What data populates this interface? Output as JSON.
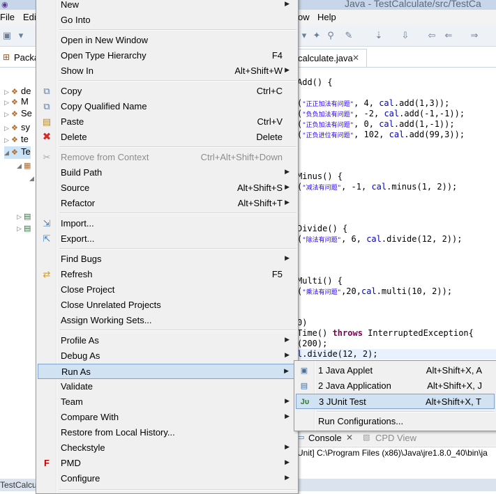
{
  "window": {
    "title": "Java - TestCalculate/src/TestCa"
  },
  "menubar": {
    "file": "File",
    "edit": "Edi",
    "window": "ow",
    "help": "Help"
  },
  "package_explorer": {
    "tab_label": "Packa",
    "tree": [
      {
        "label": "de"
      },
      {
        "label": "M"
      },
      {
        "label": "Se"
      },
      {
        "label": "sy"
      },
      {
        "label": "te"
      },
      {
        "label": "Te"
      }
    ]
  },
  "editor": {
    "tab_label": "calculate.java",
    "code_lines": {
      "l1": "Add() {",
      "l2_str": "\"正正加法有问题\"",
      "l2_rest": ", 4, ",
      "l2_f": "cal",
      "l2_end": ".add(1,3));",
      "l3_str": "\"负负加法有问题\"",
      "l3_rest": ", -2, ",
      "l3_f": "cal",
      "l3_end": ".add(-1,-1));",
      "l4_str": "\"正负加法有问题\"",
      "l4_rest": ", 0, ",
      "l4_f": "cal",
      "l4_end": ".add(1,-1));",
      "l5_str": "\"正负进位有问题\"",
      "l5_rest": ", 102, ",
      "l5_f": "cal",
      "l5_end": ".add(99,3));",
      "l6": "Minus() {",
      "l7_str": "\"减法有问题\"",
      "l7_rest": ", -1, ",
      "l7_f": "cal",
      "l7_end": ".minus(1, 2));",
      "l8": "Divide() {",
      "l9_str": "\"除法有问题\"",
      "l9_rest": ", 6, ",
      "l9_f": "cal",
      "l9_end": ".divide(12, 2));",
      "l10": "Multi() {",
      "l11_str": "\"乘法有问题\"",
      "l11_rest": ",20,",
      "l11_f": "cal",
      "l11_end": ".multi(10, 2));",
      "l12": "0)",
      "l13_a": "Time() ",
      "l13_k": "throws",
      "l13_b": " InterruptedException{",
      "l14": "(200);",
      "l15_f": "l",
      "l15_end": ".divide(12, 2);"
    }
  },
  "console": {
    "console_label": "Console",
    "cpd_label": "CPD View",
    "path": "Unit] C:\\Program Files (x86)\\Java\\jre1.8.0_40\\bin\\ja"
  },
  "bottom": {
    "label": "TestCalcul"
  },
  "context_menu": {
    "new": "New",
    "go_into": "Go Into",
    "open_new_window": "Open in New Window",
    "open_type_hierarchy": "Open Type Hierarchy",
    "open_type_hierarchy_sc": "F4",
    "show_in": "Show In",
    "show_in_sc": "Alt+Shift+W",
    "copy": "Copy",
    "copy_sc": "Ctrl+C",
    "copy_qualified": "Copy Qualified Name",
    "paste": "Paste",
    "paste_sc": "Ctrl+V",
    "delete": "Delete",
    "delete_sc": "Delete",
    "remove_context": "Remove from Context",
    "remove_context_sc": "Ctrl+Alt+Shift+Down",
    "build_path": "Build Path",
    "source": "Source",
    "source_sc": "Alt+Shift+S",
    "refactor": "Refactor",
    "refactor_sc": "Alt+Shift+T",
    "import": "Import...",
    "export": "Export...",
    "find_bugs": "Find Bugs",
    "refresh": "Refresh",
    "refresh_sc": "F5",
    "close_project": "Close Project",
    "close_unrelated": "Close Unrelated Projects",
    "assign_working_sets": "Assign Working Sets...",
    "profile_as": "Profile As",
    "debug_as": "Debug As",
    "run_as": "Run As",
    "validate": "Validate",
    "team": "Team",
    "compare_with": "Compare With",
    "restore_history": "Restore from Local History...",
    "checkstyle": "Checkstyle",
    "pmd": "PMD",
    "configure": "Configure"
  },
  "run_as_submenu": {
    "java_applet": "1 Java Applet",
    "java_applet_sc": "Alt+Shift+X, A",
    "java_application": "2 Java Application",
    "java_application_sc": "Alt+Shift+X, J",
    "junit_test": "3 JUnit Test",
    "junit_test_sc": "Alt+Shift+X, T",
    "run_configurations": "Run Configurations..."
  },
  "colors": {
    "menu_bg": "#f0f0f0",
    "highlight_bg": "#d1e2f2",
    "highlight_border": "#7da2ce",
    "string": "#2a00ff",
    "field": "#0000c0",
    "keyword": "#7f0055"
  }
}
